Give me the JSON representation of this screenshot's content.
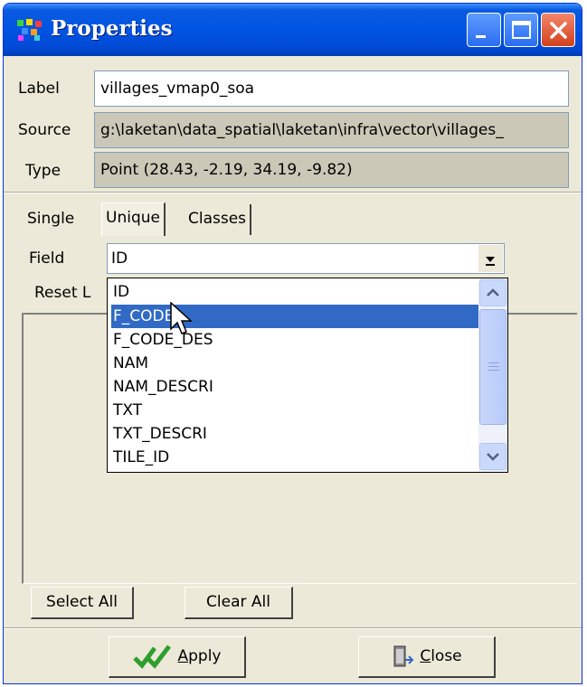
{
  "window": {
    "title": "Properties",
    "icon": "app-dots-icon",
    "controls": [
      "minimize-icon",
      "maximize-icon",
      "close-icon"
    ]
  },
  "props": {
    "label_caption": "Label",
    "label_value": "villages_vmap0_soa",
    "source_caption": "Source",
    "source_value": "g:\\laketan\\data_spatial\\laketan\\infra\\vector\\villages_",
    "type_caption": "Type",
    "type_value": "Point  (28.43, -2.19, 34.19, -9.82)"
  },
  "tabs": [
    {
      "label": "Single"
    },
    {
      "label": "Unique",
      "active": true
    },
    {
      "label": "Classes"
    }
  ],
  "field": {
    "caption": "Field",
    "selected": "ID"
  },
  "reset_label": "Reset L",
  "dropdown": {
    "options": [
      "ID",
      "F_CODE",
      "F_CODE_DES",
      "NAM",
      "NAM_DESCRI",
      "TXT",
      "TXT_DESCRI",
      "TILE_ID"
    ],
    "highlighted": "F_CODE"
  },
  "buttons": {
    "select_all": "Select All",
    "clear_all": "Clear All",
    "apply_prefix": "",
    "apply_accel": "A",
    "apply_rest": "pply",
    "close_accel": "C",
    "close_rest": "lose"
  },
  "colors": {
    "title_blue": "#0054e3",
    "selection_blue": "#316ac5",
    "window_bg": "#ece9d8",
    "apply_check": "#2e9e2e"
  }
}
